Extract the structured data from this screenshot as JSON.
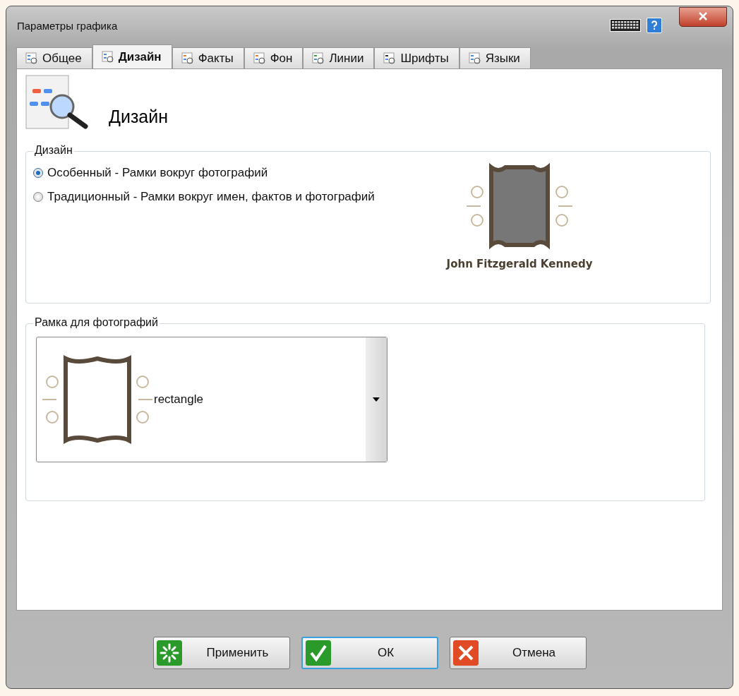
{
  "window": {
    "title": "Параметры графика"
  },
  "tabs": [
    {
      "label": "Общее",
      "selected": false
    },
    {
      "label": "Дизайн",
      "selected": true
    },
    {
      "label": "Факты",
      "selected": false
    },
    {
      "label": "Фон",
      "selected": false
    },
    {
      "label": "Линии",
      "selected": false
    },
    {
      "label": "Шрифты",
      "selected": false
    },
    {
      "label": "Языки",
      "selected": false
    }
  ],
  "page_title": "Дизайн",
  "design_group": {
    "legend": "Дизайн",
    "options": [
      {
        "label": "Особенный - Рамки вокруг фотографий",
        "selected": true
      },
      {
        "label": "Традиционный - Рамки вокруг имен, фактов и фотографий",
        "selected": false
      }
    ],
    "preview_name": "John Fitzgerald Kennedy"
  },
  "frame_group": {
    "legend": "Рамка для фотографий",
    "value": "rectangle"
  },
  "buttons": [
    {
      "label": "Применить",
      "kind": "apply",
      "focused": false
    },
    {
      "label": "ОК",
      "kind": "ok",
      "focused": true
    },
    {
      "label": "Отмена",
      "kind": "cancel",
      "focused": false
    }
  ]
}
